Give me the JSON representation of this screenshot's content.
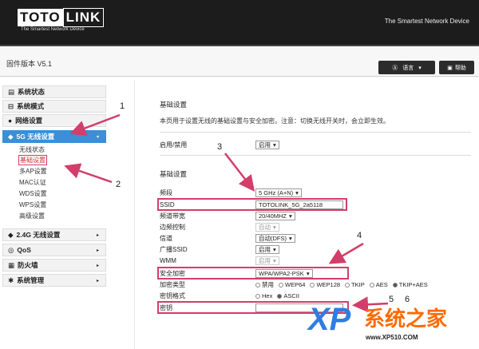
{
  "header": {
    "logo_left": "TOTO",
    "logo_right": "LINK",
    "logo_sub": "The Smartest Network Device",
    "tagline": "The Smartest Network Device"
  },
  "firmware": "固件版本 V5.1",
  "lang_btn": "语言",
  "help_btn": "帮助",
  "sidebar": {
    "items": [
      {
        "label": "系统状态"
      },
      {
        "label": "系统模式"
      },
      {
        "label": "网络设置"
      },
      {
        "label": "5G 无线设置"
      },
      {
        "label": "2.4G 无线设置"
      },
      {
        "label": "QoS"
      },
      {
        "label": "防火墙"
      },
      {
        "label": "系统管理"
      }
    ],
    "sub5g": [
      "无线状态",
      "基础设置",
      "多AP设置",
      "MAC认证",
      "WDS设置",
      "WPS设置",
      "高级设置"
    ]
  },
  "content": {
    "title1": "基础设置",
    "note": "本页用于设置无线的基础设置与安全加密。注意：切换无线开关时，会立即生效。",
    "enable_label": "启用/禁用",
    "enable_value": "启用",
    "title2": "基础设置",
    "band_label": "频段",
    "band_value": "5 GHz (A+N)",
    "ssid_label": "SSID",
    "ssid_value": "TOTOLINK_5G_2a5118",
    "bw_label": "频道带宽",
    "bw_value": "20/40MHZ",
    "side_label": "边频控制",
    "side_value": "自动",
    "channel_label": "信道",
    "channel_value": "自动(DFS)",
    "bcast_label": "广播SSID",
    "bcast_value": "启用",
    "wmm_label": "WMM",
    "wmm_value": "启用",
    "sec_label": "安全加密",
    "sec_value": "WPA/WPA2-PSK",
    "enc_label": "加密类型",
    "enc_options": [
      "禁用",
      "WEP64",
      "WEP128",
      "TKIP",
      "AES",
      "TKIP+AES"
    ],
    "keyfmt_label": "密钥格式",
    "keyfmt_options": [
      "Hex",
      "ASCII"
    ],
    "pwd_label": "密钥"
  },
  "annotations": [
    "1",
    "2",
    "3",
    "4",
    "5",
    "6"
  ],
  "watermark": {
    "xp": "XP",
    "cn": "系统之家",
    "url": "www.XP510.COM"
  }
}
